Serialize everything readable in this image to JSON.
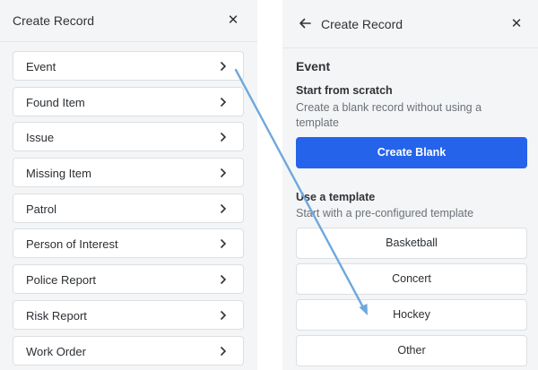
{
  "left_panel": {
    "title": "Create Record",
    "close_icon": "close-icon",
    "items": [
      {
        "label": "Event"
      },
      {
        "label": "Found Item"
      },
      {
        "label": "Issue"
      },
      {
        "label": "Missing Item"
      },
      {
        "label": "Patrol"
      },
      {
        "label": "Person of Interest"
      },
      {
        "label": "Police Report"
      },
      {
        "label": "Risk Report"
      },
      {
        "label": "Work Order"
      }
    ]
  },
  "right_panel": {
    "title": "Create Record",
    "back_icon": "arrow-left-icon",
    "close_icon": "close-icon",
    "section_title": "Event",
    "scratch": {
      "heading": "Start from scratch",
      "description": "Create a blank record without using a template",
      "button_label": "Create Blank"
    },
    "template": {
      "heading": "Use a template",
      "description": "Start with a pre-configured template",
      "options": [
        "Basketball",
        "Concert",
        "Hockey",
        "Other"
      ]
    }
  },
  "colors": {
    "primary": "#2563eb",
    "panel_bg": "#f4f5f6",
    "arrow": "#6fa8dc"
  }
}
